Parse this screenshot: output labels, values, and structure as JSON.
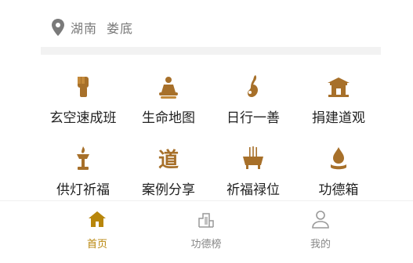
{
  "location": {
    "province": "湖南",
    "city": "娄底"
  },
  "colors": {
    "accent": "#b8860b",
    "icon": "#a7702a",
    "tab_inactive": "#888888"
  },
  "menu": [
    {
      "label": "玄空速成班",
      "icon": "fist-icon"
    },
    {
      "label": "生命地图",
      "icon": "meditation-figure-icon"
    },
    {
      "label": "日行一善",
      "icon": "hand-gesture-icon"
    },
    {
      "label": "捐建道观",
      "icon": "temple-icon"
    },
    {
      "label": "供灯祈福",
      "icon": "lamp-icon"
    },
    {
      "label": "案例分享",
      "icon": "dao-character-icon"
    },
    {
      "label": "祈福禄位",
      "icon": "incense-burner-icon"
    },
    {
      "label": "功德箱",
      "icon": "merit-drop-icon"
    }
  ],
  "menu_icon_glyph": "道",
  "tabs": [
    {
      "label": "首页",
      "icon": "home-icon",
      "active": true
    },
    {
      "label": "功德榜",
      "icon": "building-icon",
      "active": false
    },
    {
      "label": "我的",
      "icon": "user-icon",
      "active": false
    }
  ]
}
